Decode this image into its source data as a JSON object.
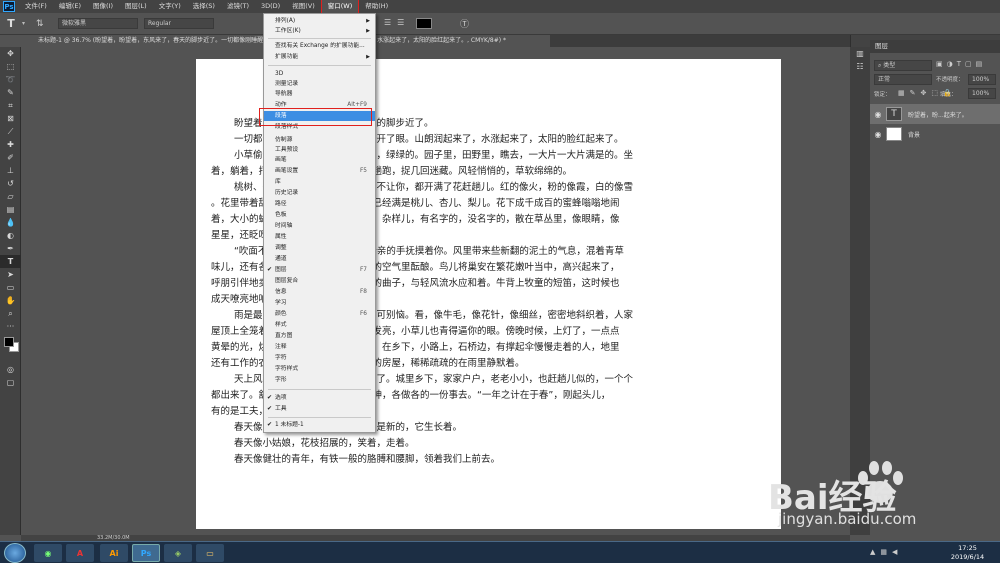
{
  "menubar": {
    "logo": "Ps",
    "items": [
      "文件(F)",
      "编辑(E)",
      "图像(I)",
      "图层(L)",
      "文字(Y)",
      "选择(S)",
      "滤镜(T)",
      "3D(D)",
      "视图(V)",
      "窗口(W)",
      "帮助(H)"
    ]
  },
  "options": {
    "font_family": "微软雅黑",
    "font_style": "Regular"
  },
  "document": {
    "tab_title": "未标题-1 @ 36.7% (盼望着，盼望着，东风来了，春天的脚步近了。一切都像刚睡醒的样子，欣欣然张开了眼。山朗润起来了，水涨起来了，太阳的脸红起来了。, CMYK/8#) *",
    "status": "33.2M/30.0M",
    "paragraphs": [
      "盼望着，盼望着，东风来了，春天的脚步近了。",
      "一切都像刚睡醒的样子，欣欣然张开了眼。山朗润起来了，水涨起来了，太阳的脸红起来了。",
      "小草偷偷地从土里钻出来，嫩嫩的，绿绿的。园子里，田野里，瞧去，一大片一大片满是的。坐",
      "着，躺着，打两个滚，踢几脚球，赛几趟跑，捉几回迷藏。风轻悄悄的，草软绵绵的。",
      "桃树、杏树、梨树，你不让我，我不让你，都开满了花赶趟儿。红的像火，粉的像霞，白的像雪",
      "。花里带着甜味儿；闭了眼，树上仿佛已经满是桃儿、杏儿、梨儿。花下成千成百的蜜蜂嗡嗡地闹",
      "着，大小的蝴蝶飞来飞去。野花遍地是：杂样儿，有名字的，没名字的，散在草丛里，像眼睛，像",
      "星星，还眨呀眨的。",
      "“吹面不寒杨柳风”，不错的，像母亲的手抚摸着你。风里带来些新翻的泥土的气息，混着青草",
      "味儿，还有各种花的香，都在微微润湿的空气里酝酿。鸟儿将巢安在繁花嫩叶当中，高兴起来了，",
      "呼朋引伴地卖弄清脆的喉咙，唱出宛转的曲子，与轻风流水应和着。牛背上牧童的短笛，这时候也",
      "成天嘹亮地响着。",
      "雨是最寻常的，一下就是三两天。可别恼。看，像牛毛，像花针，像细丝，密密地斜织着，人家",
      "屋顶上全笼着一层薄烟。树叶儿却绿得发亮，小草儿也青得逼你的眼。傍晚时候，上灯了，一点点",
      "黄晕的光，烘托出一片安静而和平的夜。在乡下，小路上，石桥边，有撑起伞慢慢走着的人，地里",
      "还有工作的农民，披着蓑戴着笠。他们的房屋，稀稀疏疏的在雨里静默着。",
      "天上风筝渐渐多了，地上孩子也多了。城里乡下，家家户户，老老小小，也赶趟儿似的，一个个",
      "都出来了。舒活舒活筋骨，抖擞抖擞精神，各做各的一份事去。“一年之计在于春”，刚起头儿，",
      "有的是工夫，有的是希望。",
      "春天像刚落地的娃娃，从头到脚都是新的，它生长着。",
      "春天像小姑娘，花枝招展的，笑着，走着。",
      "春天像健壮的青年，有铁一般的胳膊和腰脚，领着我们上前去。"
    ]
  },
  "window_menu": {
    "items": [
      {
        "label": "排列(A)",
        "arrow": true
      },
      {
        "label": "工作区(K)",
        "arrow": true
      },
      {
        "label": "查找有关 Exchange 的扩展功能..."
      },
      {
        "label": "扩展功能",
        "arrow": true
      },
      {
        "label": "3D"
      },
      {
        "label": "测量记录"
      },
      {
        "label": "导航器"
      },
      {
        "label": "动作",
        "shortcut": "Alt+F9"
      },
      {
        "label": "段落",
        "highlighted": true
      },
      {
        "label": "段落样式"
      },
      {
        "label": "仿制源"
      },
      {
        "label": "工具预设"
      },
      {
        "label": "画笔"
      },
      {
        "label": "画笔设置",
        "shortcut": "F5"
      },
      {
        "label": "库"
      },
      {
        "label": "历史记录"
      },
      {
        "label": "路径"
      },
      {
        "label": "色板"
      },
      {
        "label": "时间轴"
      },
      {
        "label": "属性"
      },
      {
        "label": "调整"
      },
      {
        "label": "通道"
      },
      {
        "label": "图层",
        "shortcut": "F7",
        "checked": true
      },
      {
        "label": "图层复合"
      },
      {
        "label": "信息",
        "shortcut": "F8"
      },
      {
        "label": "学习"
      },
      {
        "label": "颜色",
        "shortcut": "F6"
      },
      {
        "label": "样式"
      },
      {
        "label": "直方图"
      },
      {
        "label": "注释"
      },
      {
        "label": "字符"
      },
      {
        "label": "字符样式"
      },
      {
        "label": "字形"
      },
      {
        "label": "选项",
        "checked": true
      },
      {
        "label": "工具",
        "checked": true
      },
      {
        "label": "1 未标题-1",
        "checked": true
      }
    ]
  },
  "layers_panel": {
    "title": "图层",
    "filter": "类型",
    "blend_mode": "正常",
    "opacity_label": "不透明度：",
    "opacity": "100%",
    "lock_label": "锁定：",
    "fill_label": "填充：",
    "fill": "100%",
    "layers": [
      {
        "name": "盼望着，盼...起来了。",
        "type": "T",
        "selected": true
      },
      {
        "name": "背景",
        "type": ""
      }
    ]
  },
  "taskbar": {
    "time": "17:25",
    "date": "2019/6/14"
  },
  "watermark": {
    "brand": "Bai经验",
    "url": "jingyan.baidu.com"
  },
  "colors": {
    "accent_red": "#e0201d",
    "menu_highlight": "#3d8ee3"
  }
}
